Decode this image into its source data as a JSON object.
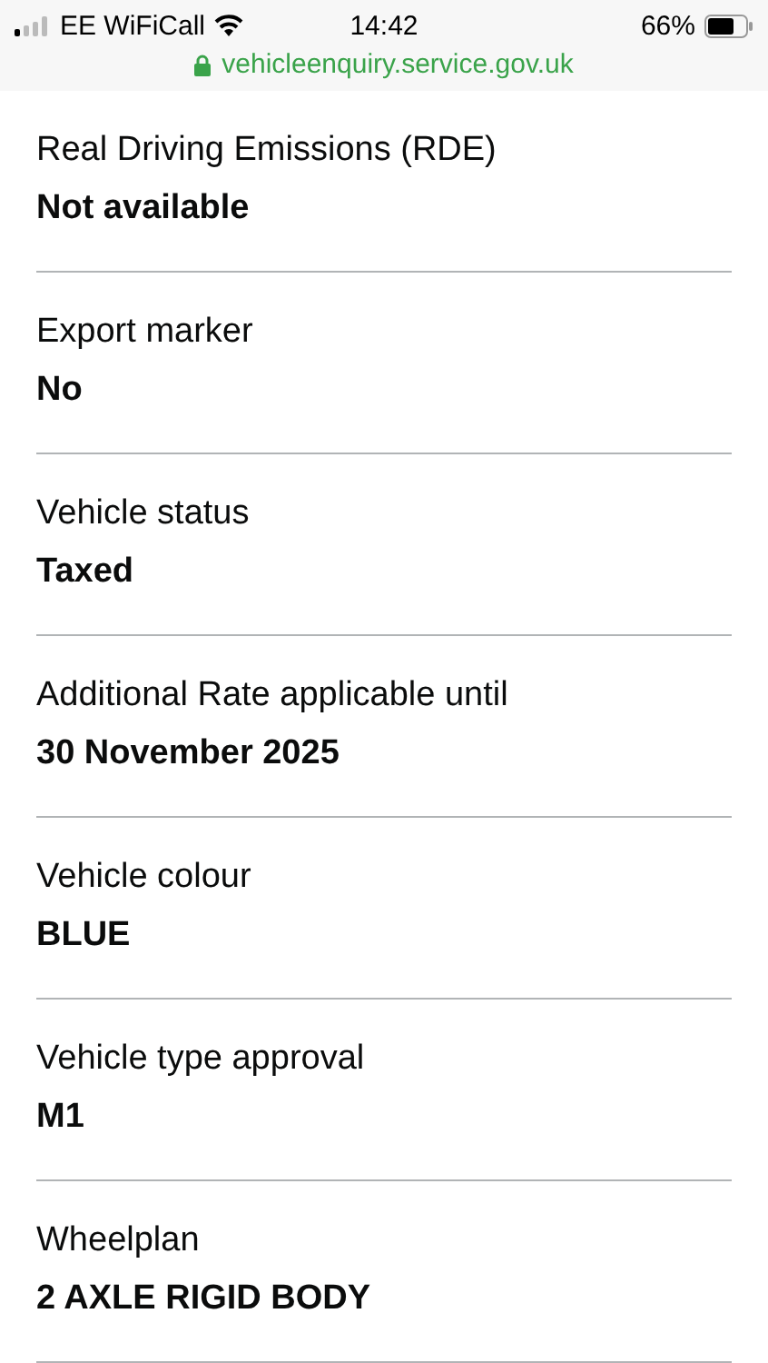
{
  "status_bar": {
    "carrier": "EE WiFiCall",
    "time": "14:42",
    "battery": "66%"
  },
  "address_bar": {
    "url": "vehicleenquiry.service.gov.uk"
  },
  "details": [
    {
      "label": "Real Driving Emissions (RDE)",
      "value": "Not available"
    },
    {
      "label": "Export marker",
      "value": "No"
    },
    {
      "label": "Vehicle status",
      "value": "Taxed"
    },
    {
      "label": "Additional Rate applicable until",
      "value": "30 November 2025"
    },
    {
      "label": "Vehicle colour",
      "value": "BLUE"
    },
    {
      "label": "Vehicle type approval",
      "value": "M1"
    },
    {
      "label": "Wheelplan",
      "value": "2 AXLE RIGID BODY"
    }
  ]
}
